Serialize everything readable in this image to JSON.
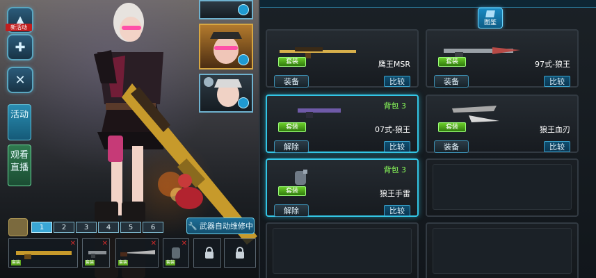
{
  "left": {
    "new_event_badge": "新活动",
    "tabs": [
      "活动",
      "观看直播"
    ],
    "repair_button": "武器自动维修中",
    "loadout_tabs": [
      "1",
      "2",
      "3",
      "4",
      "5",
      "6"
    ],
    "slot_badge": "套装"
  },
  "right": {
    "codex_label": "图鉴",
    "cards": [
      {
        "name": "鹰王MSR",
        "tag": "套装",
        "action": "装备",
        "compare": "比较",
        "bag": ""
      },
      {
        "name": "97式-狼王",
        "tag": "套装",
        "action": "装备",
        "compare": "比较",
        "bag": ""
      },
      {
        "name": "07式-狼王",
        "tag": "套装",
        "action": "解除",
        "compare": "比较",
        "bag": "背包 3"
      },
      {
        "name": "狼王血刃",
        "tag": "套装",
        "action": "装备",
        "compare": "比较",
        "bag": ""
      },
      {
        "name": "狼王手雷",
        "tag": "套装",
        "action": "解除",
        "compare": "比较",
        "bag": "背包 3"
      }
    ]
  },
  "colors": {
    "accent_cyan": "#33c6e6",
    "set_green": "#6ccf2a",
    "bag_green": "#8bff5a",
    "new_red": "#c21e1e"
  }
}
